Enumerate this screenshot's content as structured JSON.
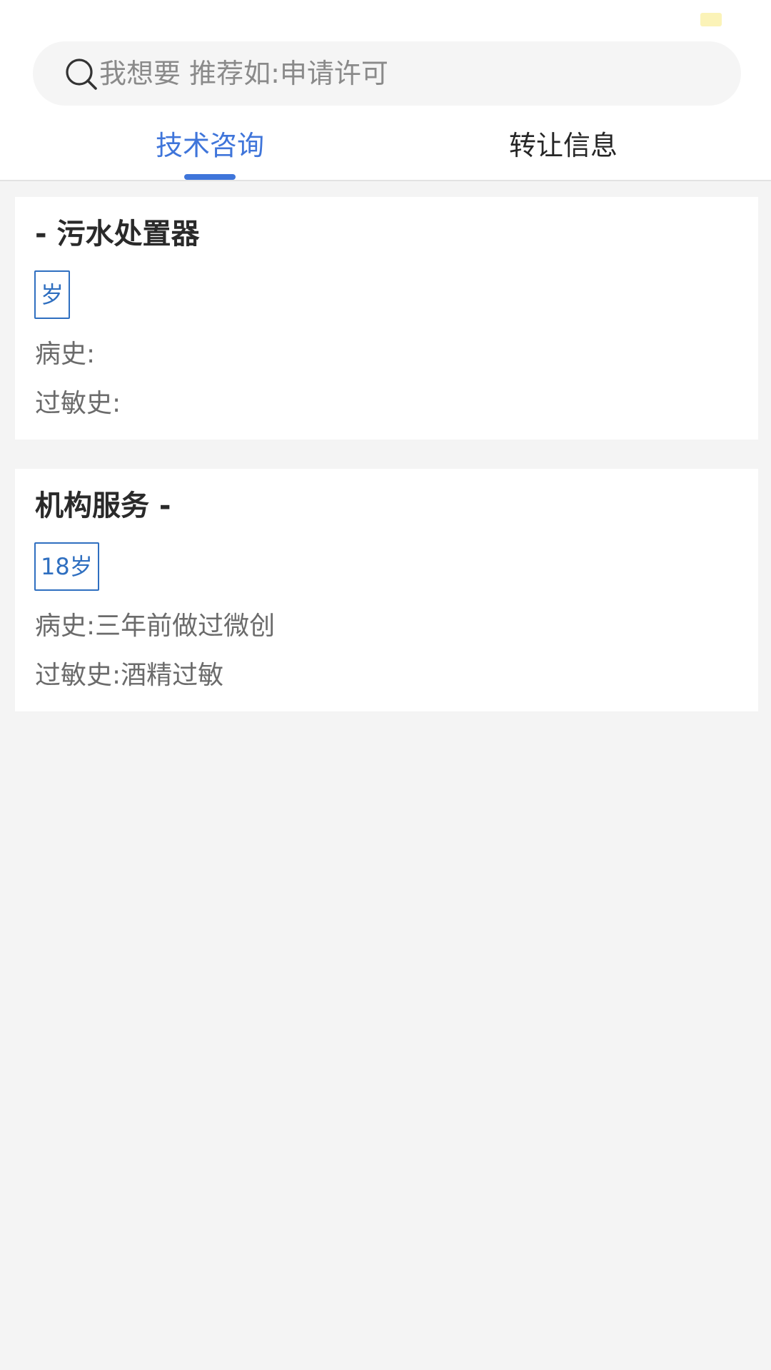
{
  "search": {
    "placeholder": "我想要 推荐如:申请许可"
  },
  "tabs": [
    {
      "label": "技术咨询",
      "active": true
    },
    {
      "label": "转让信息",
      "active": false
    }
  ],
  "colors": {
    "accent": "#3f75da",
    "badge": "#2f6fc0"
  },
  "cards": [
    {
      "title": "- 污水处置器",
      "age": "岁",
      "history": "病史:",
      "allergy": "过敏史:"
    },
    {
      "title": "机构服务 -",
      "age": "18岁",
      "history": "病史:三年前做过微创",
      "allergy": "过敏史:酒精过敏"
    }
  ]
}
